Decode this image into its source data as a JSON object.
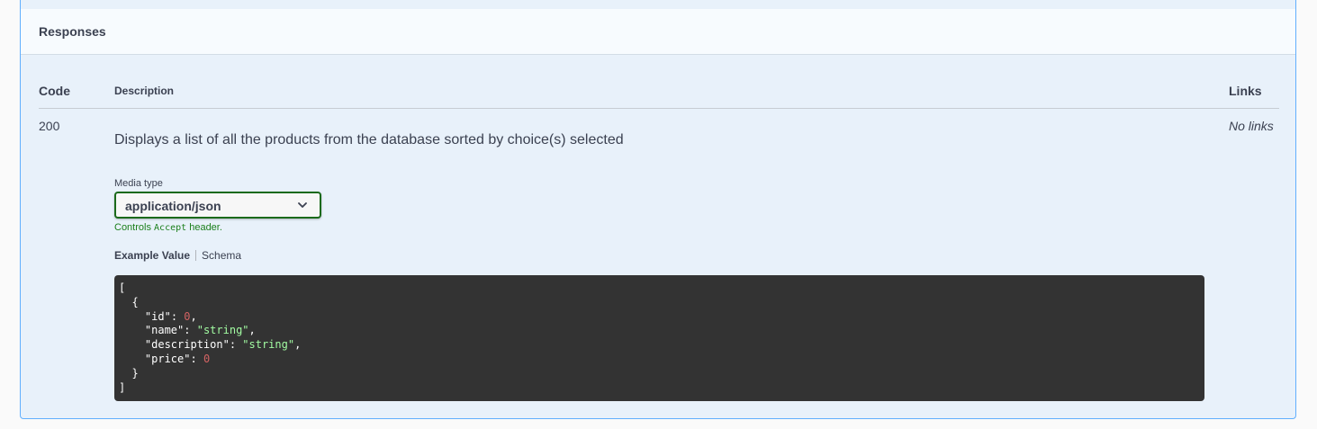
{
  "responses": {
    "title": "Responses",
    "columns": {
      "code": "Code",
      "description": "Description",
      "links": "Links"
    },
    "rows": [
      {
        "code": "200",
        "description": "Displays a list of all the products from the database sorted by choice(s) selected",
        "links": "No links",
        "media_type_label": "Media type",
        "media_type_value": "application/json",
        "controls_hint_prefix": "Controls ",
        "controls_hint_code": "Accept",
        "controls_hint_suffix": " header.",
        "tabs": [
          "Example Value",
          "Schema"
        ],
        "example": {
          "open_bracket": "[",
          "open_brace": "{",
          "fields": [
            {
              "key": "\"id\"",
              "value": "0",
              "type": "num",
              "trail": ","
            },
            {
              "key": "\"name\"",
              "value": "\"string\"",
              "type": "str",
              "trail": ","
            },
            {
              "key": "\"description\"",
              "value": "\"string\"",
              "type": "str",
              "trail": ","
            },
            {
              "key": "\"price\"",
              "value": "0",
              "type": "num",
              "trail": ""
            }
          ],
          "close_brace": "}",
          "close_bracket": "]"
        }
      }
    ]
  },
  "colors": {
    "accent_border": "#61affe",
    "panel_bg": "#e8f1fa",
    "select_border": "#1b6a1b",
    "hint_green": "#1b7f1b",
    "code_bg": "#333333",
    "string_token": "#a2fca2",
    "number_token": "#d36363"
  }
}
